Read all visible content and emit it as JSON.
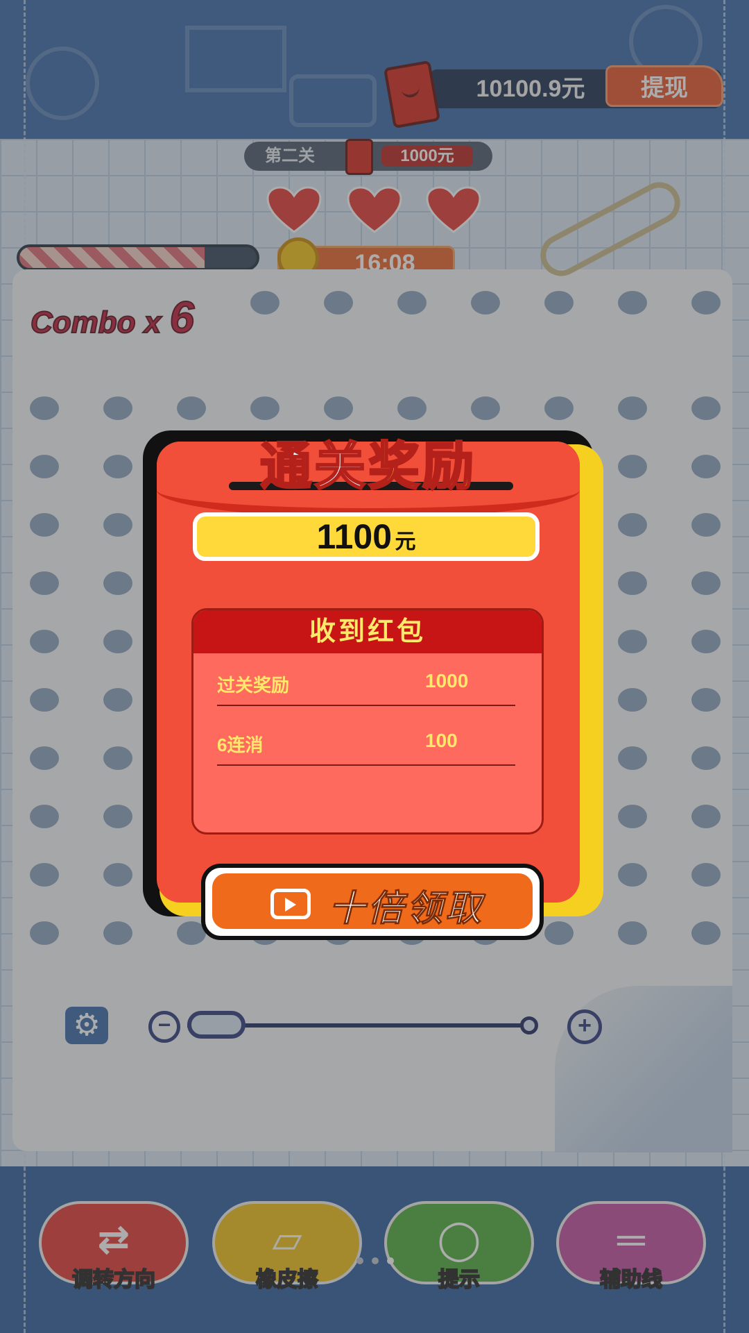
{
  "header": {
    "balance": "10100.9元",
    "withdraw_label": "提现"
  },
  "level": {
    "name": "第二关",
    "reward": "1000元"
  },
  "lives": 3,
  "timer": "16:08",
  "progress": 0.78,
  "combo": {
    "text": "Combo x ",
    "count": "6"
  },
  "modal": {
    "title_part1": "通关",
    "title_part2": "奖励",
    "amount": "1100",
    "amount_unit": "元",
    "panel_title": "收到红包",
    "rows": [
      {
        "label": "过关奖励",
        "value": "1000"
      },
      {
        "label": "6连消",
        "value": "100"
      }
    ],
    "claim_label": "十倍领取"
  },
  "toolbar": {
    "items": [
      {
        "label": "调转方向",
        "icon": "swap-icon",
        "color": "#e23a36"
      },
      {
        "label": "橡皮擦",
        "icon": "eraser-icon",
        "color": "#f2c218"
      },
      {
        "label": "提示",
        "icon": "bulb-icon",
        "color": "#4fae3c"
      },
      {
        "label": "辅助线",
        "icon": "guide-lines-icon",
        "color": "#c14fa2"
      }
    ]
  },
  "page_indicator": {
    "count": 3,
    "active": 2
  }
}
